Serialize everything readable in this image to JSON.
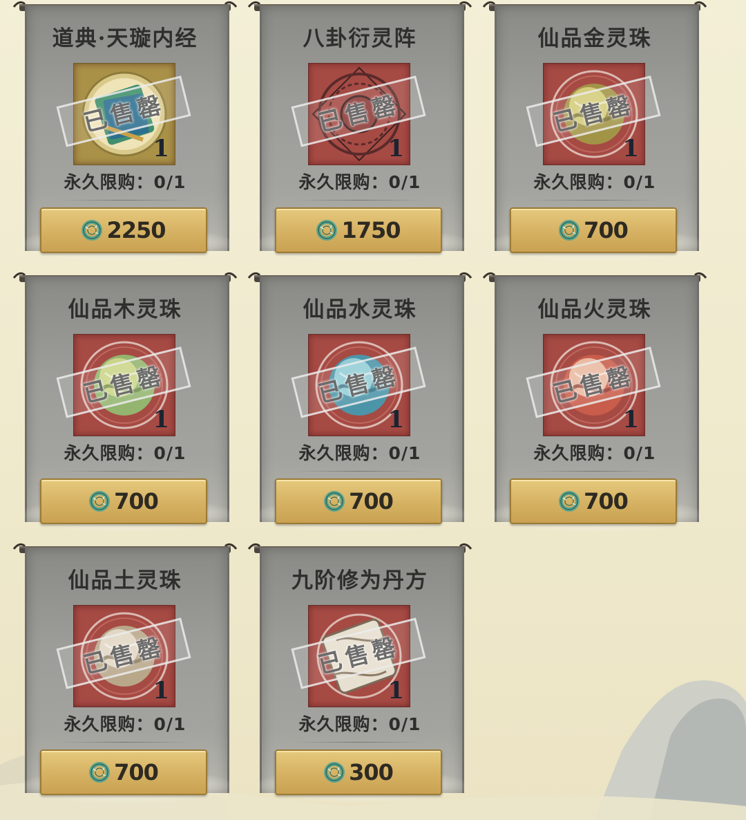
{
  "shop": {
    "items": [
      {
        "name": "道典·天璇内经",
        "stamp": "已售罄",
        "qty": "1",
        "limit": "永久限购：0/1",
        "price": "2250",
        "art": "book"
      },
      {
        "name": "八卦衍灵阵",
        "stamp": "已售罄",
        "qty": "1",
        "limit": "永久限购：0/1",
        "price": "1750",
        "art": "bagua"
      },
      {
        "name": "仙品金灵珠",
        "stamp": "已售罄",
        "qty": "1",
        "limit": "永久限购：0/1",
        "price": "700",
        "art": "orb-gold"
      },
      {
        "name": "仙品木灵珠",
        "stamp": "已售罄",
        "qty": "1",
        "limit": "永久限购：0/1",
        "price": "700",
        "art": "orb-wood"
      },
      {
        "name": "仙品水灵珠",
        "stamp": "已售罄",
        "qty": "1",
        "limit": "永久限购：0/1",
        "price": "700",
        "art": "orb-water"
      },
      {
        "name": "仙品火灵珠",
        "stamp": "已售罄",
        "qty": "1",
        "limit": "永久限购：0/1",
        "price": "700",
        "art": "orb-fire"
      },
      {
        "name": "仙品土灵珠",
        "stamp": "已售罄",
        "qty": "1",
        "limit": "永久限购：0/1",
        "price": "700",
        "art": "orb-earth"
      },
      {
        "name": "九阶修为丹方",
        "stamp": "已售罄",
        "qty": "1",
        "limit": "永久限购：0/1",
        "price": "300",
        "art": "scroll"
      }
    ],
    "colors": {
      "background": "#f1ecd2",
      "panel": "#9c9c98",
      "item_frame": "#a64a44",
      "price_button": "#d7b365",
      "jade_currency": "#5fa58f"
    },
    "currency_icon": "jade-ring-icon"
  }
}
